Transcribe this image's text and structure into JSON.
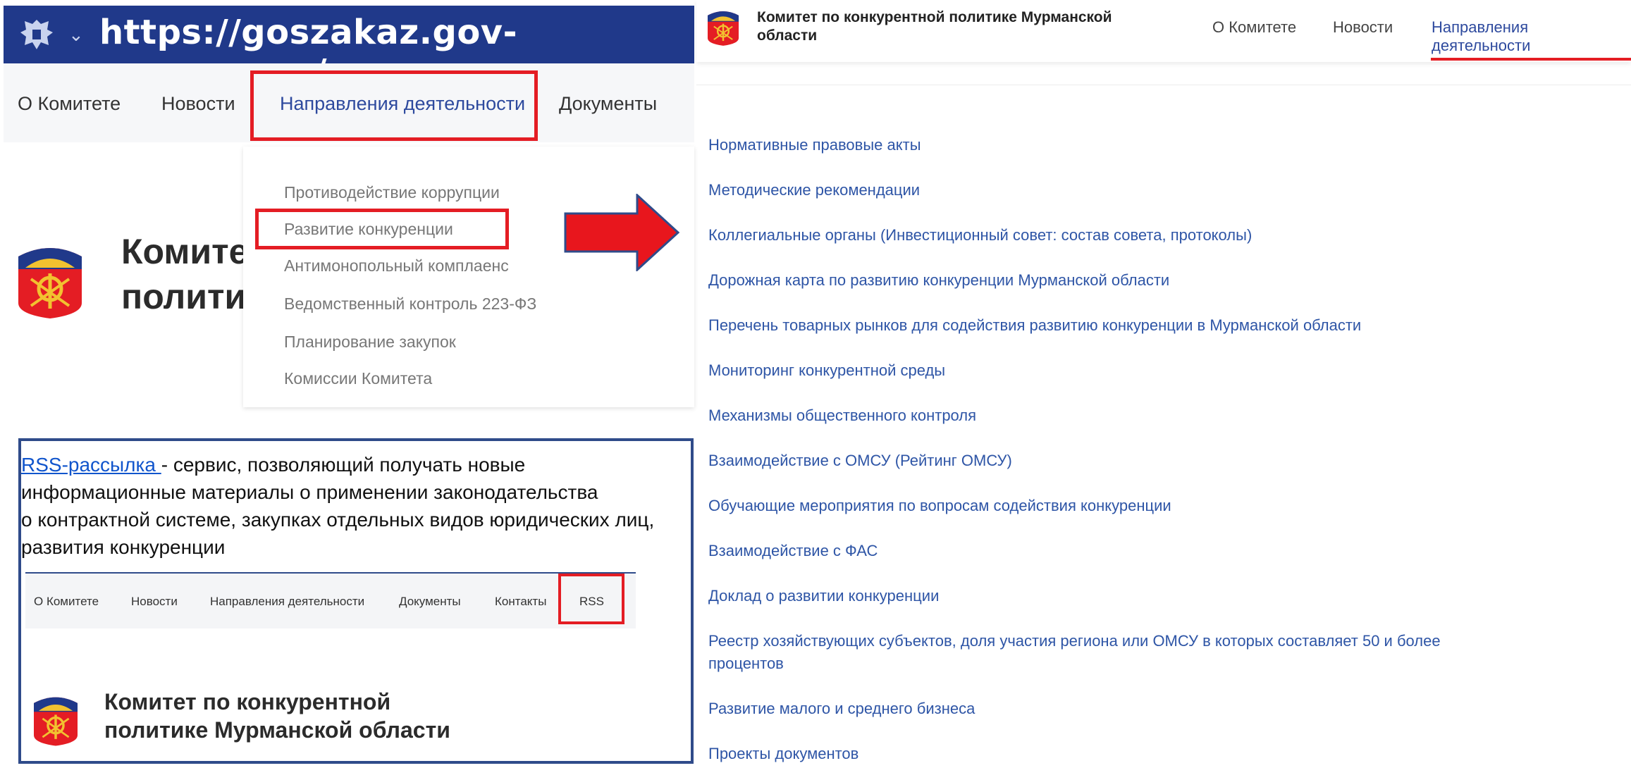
{
  "banner": {
    "url": "https://goszakaz.gov-murman.ru/",
    "chevron": "⌄",
    "crest_icon": "russia-crest-icon"
  },
  "left_nav": {
    "items": [
      "О Комитете",
      "Новости",
      "Направления деятельности",
      "Документы"
    ]
  },
  "dropdown": {
    "items": [
      "Противодействие коррупции",
      "Развитие конкуренции",
      "Антимонопольный комплаенс",
      "Ведомственный контроль 223-ФЗ",
      "Планирование закупок",
      "Комиссии Комитета"
    ]
  },
  "heading_behind": {
    "line1": "Комитет",
    "line2": "полити"
  },
  "rss": {
    "link_text": "RSS-рассылка ",
    "description_lines": [
      "- сервис, позволяющий получать новые",
      "информационные материалы о применении законодательства",
      "о контрактной системе, закупках отдельных видов юридических лиц,",
      "развития конкуренции"
    ],
    "nav_items": [
      "О Комитете",
      "Новости",
      "Направления деятельности",
      "Документы",
      "Контакты",
      "RSS"
    ],
    "title_line1": "Комитет по конкурентной",
    "title_line2": "политике Мурманской области"
  },
  "right_header": {
    "title": "Комитет по конкурентной политике Мурманской области",
    "nav": [
      "О Комитете",
      "Новости",
      "Направления деятельности"
    ]
  },
  "right_links": [
    "Нормативные правовые акты",
    "Методические рекомендации",
    "Коллегиальные органы (Инвестиционный совет: состав совета, протоколы)",
    "Дорожная карта по развитию конкуренции Мурманской области",
    "Перечень товарных рынков для содействия развитию конкуренции в Мурманской области",
    "Мониторинг конкурентной среды",
    "Механизмы общественного контроля",
    "Взаимодействие с ОМСУ (Рейтинг ОМСУ)",
    "Обучающие мероприятия по вопросам содействия конкуренции",
    "Взаимодействие с ФАС",
    "Доклад о развитии конкуренции",
    "Реестр хозяйствующих субъектов, доля участия региона или ОМСУ в которых составляет 50 и более процентов",
    "Развитие малого и среднего бизнеса",
    "Проекты документов"
  ],
  "colors": {
    "accent": "#2e4a9e",
    "highlight": "#e41d24",
    "banner": "#20398a",
    "link": "#2e55a6"
  }
}
